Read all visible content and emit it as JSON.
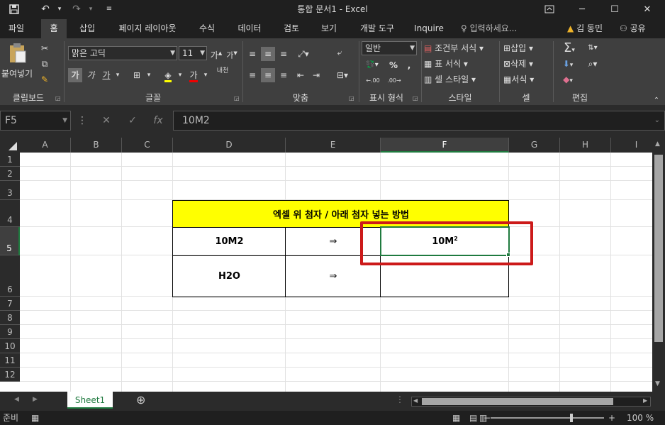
{
  "window": {
    "title": "통합 문서1 - Excel",
    "qa_icons": [
      "save-icon",
      "undo-icon",
      "redo-icon",
      "customize-icon"
    ]
  },
  "tabs": [
    "파일",
    "홈",
    "삽입",
    "페이지 레이아웃",
    "수식",
    "데이터",
    "검토",
    "보기",
    "개발 도구",
    "Inquire"
  ],
  "tell_me": "입력하세요...",
  "user": {
    "name": "김 동민",
    "share": "공유"
  },
  "ribbon": {
    "clipboard": {
      "paste": "붙여넣기",
      "label": "클립보드"
    },
    "font": {
      "name": "맑은 고딕",
      "size": "11",
      "bold": "가",
      "italic": "가",
      "underline": "가",
      "label": "글꼴",
      "phonetic": "내천"
    },
    "align": {
      "label": "맞춤"
    },
    "number": {
      "format": "일반",
      "label": "표시 형식",
      "percent": "%",
      "comma": ","
    },
    "styles": {
      "cond": "조건부 서식",
      "table": "표 서식",
      "cell": "셀 스타일",
      "label": "스타일"
    },
    "cells": {
      "insert": "삽입",
      "delete": "삭제",
      "format": "서식",
      "label": "셀"
    },
    "editing": {
      "label": "편집"
    }
  },
  "formula_bar": {
    "name_box": "F5",
    "value": "10M2"
  },
  "columns": [
    "A",
    "B",
    "C",
    "D",
    "E",
    "F",
    "G",
    "H",
    "I"
  ],
  "rows": [
    "1",
    "2",
    "3",
    "4",
    "5",
    "6",
    "7",
    "8",
    "9",
    "10",
    "11",
    "12"
  ],
  "table": {
    "title": "엑셀 위 첨자 / 아래 첨자 넣는 방법",
    "r5": {
      "input": "10M2",
      "arrow": "⇒",
      "result_base": "10M",
      "result_sup": "2"
    },
    "r6": {
      "input": "H2O",
      "arrow": "⇒",
      "result": ""
    }
  },
  "sheet": {
    "tab": "Sheet1",
    "add": "⊕"
  },
  "status": {
    "mode": "준비",
    "zoom": "100 %"
  },
  "colors": {
    "title_bg": "#ffff00",
    "highlight": "#cc1a1a",
    "select": "#1f7a3f"
  }
}
